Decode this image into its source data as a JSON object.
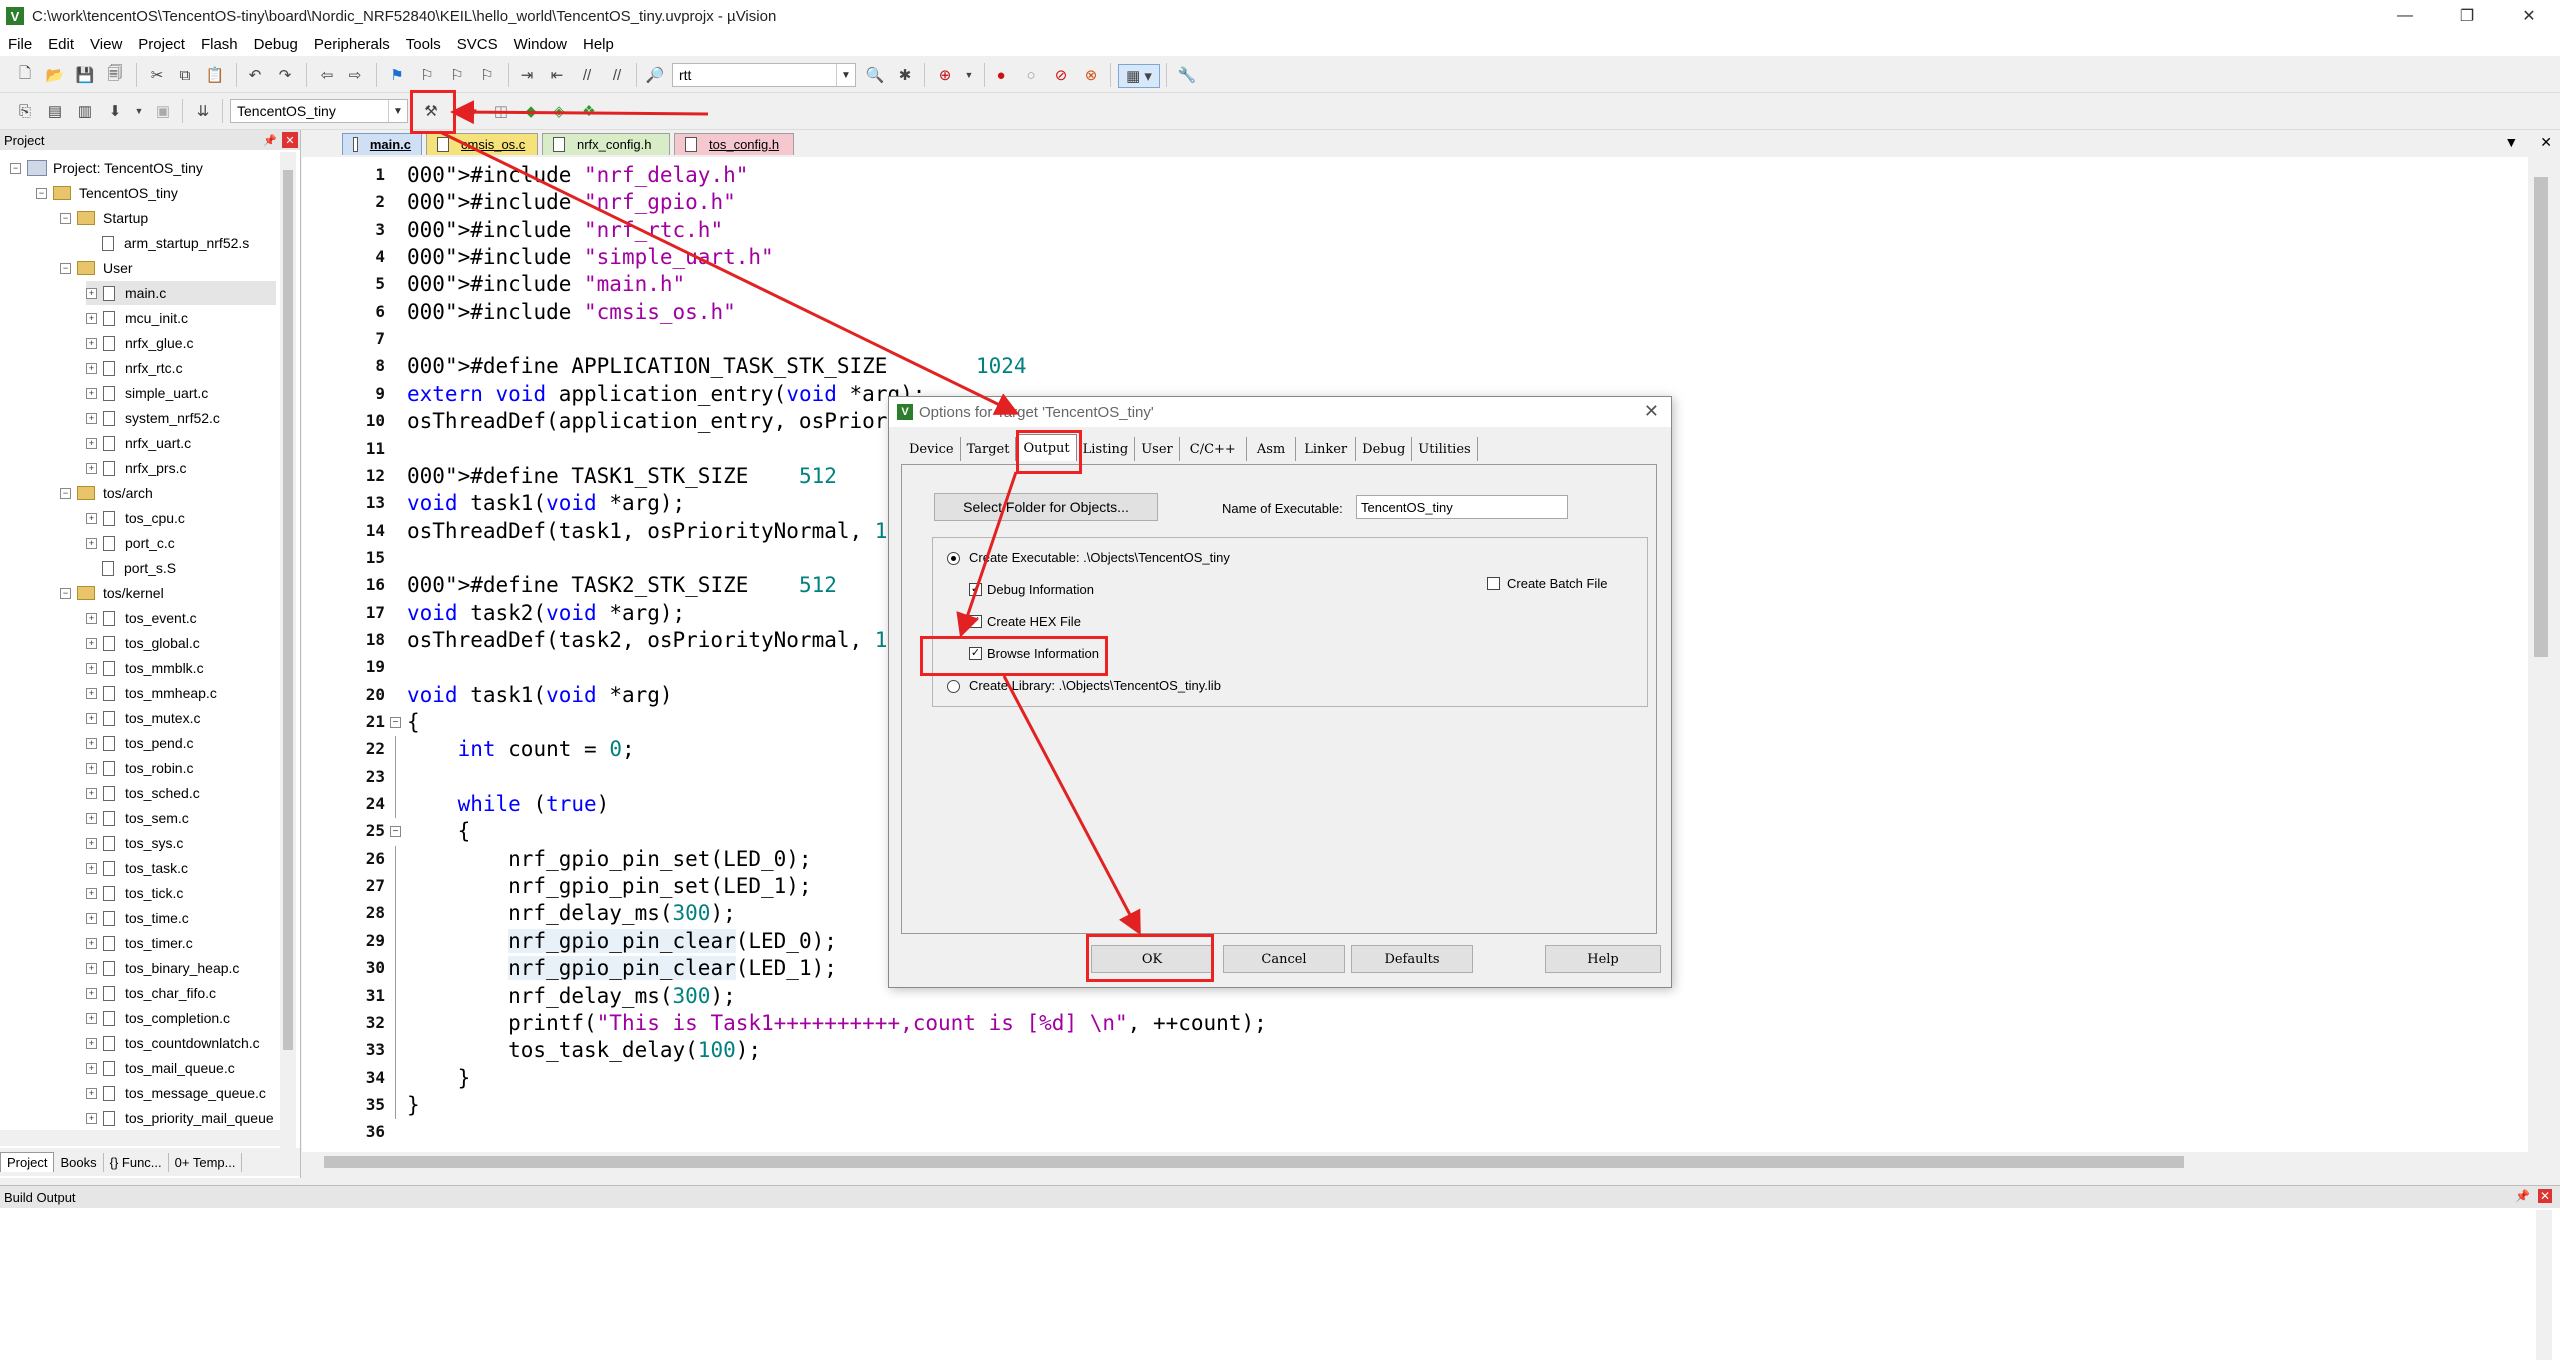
{
  "window": {
    "title": "C:\\work\\tencentOS\\TencentOS-tiny\\board\\Nordic_NRF52840\\KEIL\\hello_world\\TencentOS_tiny.uvprojx - µVision",
    "app_icon": "V",
    "minimize": "—",
    "maximize": "❐",
    "close": "✕"
  },
  "menu": [
    "File",
    "Edit",
    "View",
    "Project",
    "Flash",
    "Debug",
    "Peripherals",
    "Tools",
    "SVCS",
    "Window",
    "Help"
  ],
  "toolbar": {
    "find_text": "rtt",
    "target_select": "TencentOS_tiny"
  },
  "project_panel": {
    "title": "Project",
    "root": "Project: TencentOS_tiny",
    "target": "TencentOS_tiny",
    "groups": [
      {
        "name": "Startup",
        "files": [
          "arm_startup_nrf52.s"
        ]
      },
      {
        "name": "User",
        "files": [
          "main.c",
          "mcu_init.c",
          "nrfx_glue.c",
          "nrfx_rtc.c",
          "simple_uart.c",
          "system_nrf52.c",
          "nrfx_uart.c",
          "nrfx_prs.c"
        ]
      },
      {
        "name": "tos/arch",
        "files": [
          "tos_cpu.c",
          "port_c.c",
          "port_s.S"
        ]
      },
      {
        "name": "tos/kernel",
        "files": [
          "tos_event.c",
          "tos_global.c",
          "tos_mmblk.c",
          "tos_mmheap.c",
          "tos_mutex.c",
          "tos_pend.c",
          "tos_robin.c",
          "tos_sched.c",
          "tos_sem.c",
          "tos_sys.c",
          "tos_task.c",
          "tos_tick.c",
          "tos_time.c",
          "tos_timer.c",
          "tos_binary_heap.c",
          "tos_char_fifo.c",
          "tos_completion.c",
          "tos_countdownlatch.c",
          "tos_mail_queue.c",
          "tos_message_queue.c",
          "tos_priority_mail_queue"
        ]
      }
    ],
    "bottom_tabs": [
      "Project",
      "Books",
      "{} Func...",
      "0+ Temp..."
    ]
  },
  "editor_tabs": [
    {
      "label": "main.c",
      "color": "#cfe0f5"
    },
    {
      "label": "cmsis_os.c",
      "color": "#f5e27a"
    },
    {
      "label": "nrfx_config.h",
      "color": "#d8ecc8"
    },
    {
      "label": "tos_config.h",
      "color": "#f5c8d0"
    }
  ],
  "code": {
    "line_numbers": [
      "1",
      "2",
      "3",
      "4",
      "5",
      "6",
      "7",
      "8",
      "9",
      "10",
      "11",
      "12",
      "13",
      "14",
      "15",
      "16",
      "17",
      "18",
      "19",
      "20",
      "21",
      "22",
      "23",
      "24",
      "25",
      "26",
      "27",
      "28",
      "29",
      "30",
      "31",
      "32",
      "33",
      "34",
      "35",
      "36"
    ],
    "lines": [
      "#include \"nrf_delay.h\"",
      "#include \"nrf_gpio.h\"",
      "#include \"nrf_rtc.h\"",
      "#include \"simple_uart.h\"",
      "#include \"main.h\"",
      "#include \"cmsis_os.h\"",
      "",
      "#define APPLICATION_TASK_STK_SIZE       1024",
      "extern void application_entry(void *arg);",
      "osThreadDef(application_entry, osPriori",
      "",
      "#define TASK1_STK_SIZE    512",
      "void task1(void *arg);",
      "osThreadDef(task1, osPriorityNormal, 1,",
      "",
      "#define TASK2_STK_SIZE    512",
      "void task2(void *arg);",
      "osThreadDef(task2, osPriorityNormal, 1,",
      "",
      "void task1(void *arg)",
      "{",
      "    int count = 0;",
      "",
      "    while (true)",
      "    {",
      "        nrf_gpio_pin_set(LED_0);",
      "        nrf_gpio_pin_set(LED_1);",
      "        nrf_delay_ms(300);",
      "        nrf_gpio_pin_clear(LED_0);",
      "        nrf_gpio_pin_clear(LED_1);",
      "        nrf_delay_ms(300);",
      "        printf(\"This is Task1++++++++++,count is [%d] \\n\", ++count);",
      "        tos_task_delay(100);",
      "    }",
      "}",
      ""
    ]
  },
  "build_output": {
    "title": "Build Output"
  },
  "dialog": {
    "title": "Options for Target 'TencentOS_tiny'",
    "tabs": [
      "Device",
      "Target",
      "Output",
      "Listing",
      "User",
      "C/C++",
      "Asm",
      "Linker",
      "Debug",
      "Utilities"
    ],
    "active_tab": "Output",
    "select_folder_button": "Select Folder for Objects...",
    "name_label": "Name of Executable:",
    "name_value": "TencentOS_tiny",
    "create_executable_label": "Create Executable:  .\\Objects\\TencentOS_tiny",
    "debug_info_label": "Debug Information",
    "create_hex_label": "Create HEX File",
    "browse_info_label": "Browse Information",
    "create_batch_label": "Create Batch File",
    "create_library_label": "Create Library:  .\\Objects\\TencentOS_tiny.lib",
    "ok": "OK",
    "cancel": "Cancel",
    "defaults": "Defaults",
    "help": "Help",
    "debug_info_checked": true,
    "create_hex_checked": true,
    "browse_info_checked": true,
    "create_batch_checked": false
  },
  "annotation_color": "#e22222"
}
